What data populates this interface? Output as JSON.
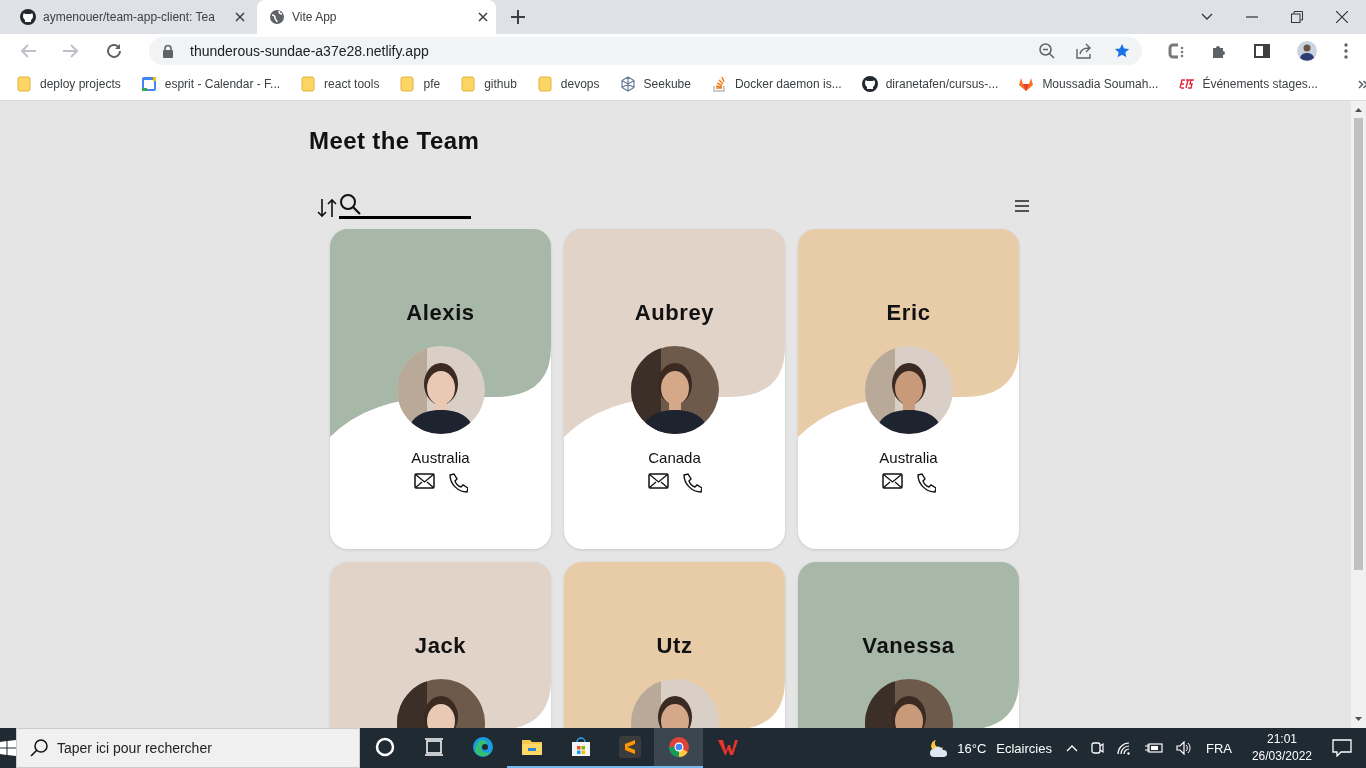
{
  "browser": {
    "tabs": [
      {
        "title": "aymenouer/team-app-client: Tea",
        "kind": "github",
        "selected": false
      },
      {
        "title": "Vite App",
        "kind": "globe",
        "selected": true
      }
    ],
    "url": "thunderous-sundae-a37e28.netlify.app",
    "bookmarked": true,
    "bookmarks": [
      {
        "label": "deploy projects",
        "kind": "folder"
      },
      {
        "label": "esprit - Calendar - F...",
        "kind": "calendar"
      },
      {
        "label": "react tools",
        "kind": "folder"
      },
      {
        "label": "pfe",
        "kind": "folder"
      },
      {
        "label": "github",
        "kind": "folder"
      },
      {
        "label": "devops",
        "kind": "folder"
      },
      {
        "label": "Seekube",
        "kind": "cube"
      },
      {
        "label": "Docker daemon is...",
        "kind": "stack"
      },
      {
        "label": "diranetafen/cursus-...",
        "kind": "github"
      },
      {
        "label": "Moussadia Soumah...",
        "kind": "fox"
      },
      {
        "label": "Événements stages...",
        "kind": "ets"
      }
    ]
  },
  "page": {
    "title": "Meet the Team",
    "members": [
      {
        "name": "Alexis",
        "country": "Australia",
        "color": "#a7b8a8"
      },
      {
        "name": "Aubrey",
        "country": "Canada",
        "color": "#e2d3c8"
      },
      {
        "name": "Eric",
        "country": "Australia",
        "color": "#e8cca8"
      },
      {
        "name": "Jack",
        "color": "#e2d3c8"
      },
      {
        "name": "Utz",
        "color": "#e8cca8"
      },
      {
        "name": "Vanessa",
        "color": "#a7b8a8"
      }
    ]
  },
  "taskbar": {
    "search_placeholder": "Taper ici pour rechercher",
    "apps": [
      {
        "kind": "cortana",
        "running": false,
        "selected": false
      },
      {
        "kind": "taskview",
        "running": false,
        "selected": false
      },
      {
        "kind": "edge",
        "running": false,
        "selected": false
      },
      {
        "kind": "explorer",
        "running": true,
        "selected": false
      },
      {
        "kind": "store",
        "running": true,
        "selected": false
      },
      {
        "kind": "sublime",
        "running": true,
        "selected": false
      },
      {
        "kind": "chrome",
        "running": true,
        "selected": true
      },
      {
        "kind": "wps",
        "running": false,
        "selected": false
      }
    ],
    "temperature": "16°C",
    "weather": "Eclaircies",
    "language": "FRA",
    "time": "21:01",
    "date": "26/03/2022"
  }
}
